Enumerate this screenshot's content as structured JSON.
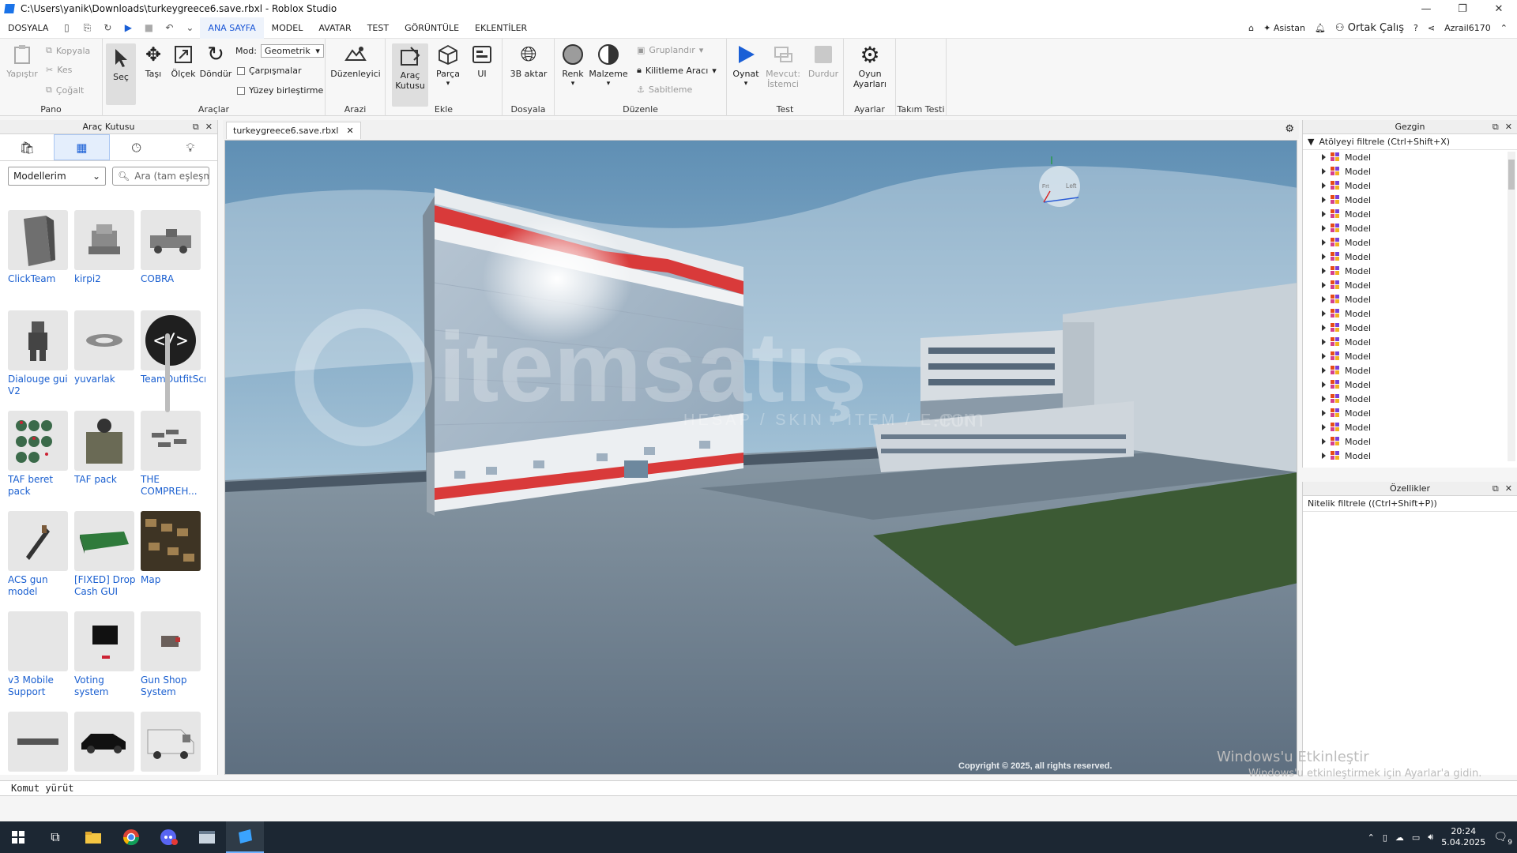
{
  "window": {
    "title": "C:\\Users\\yanik\\Downloads\\turkeygreece6.save.rbxl - Roblox Studio",
    "minimize": "—",
    "restore": "❐",
    "close": "✕"
  },
  "menu": {
    "tabs": [
      "DOSYALA",
      "ANA SAYFA",
      "MODEL",
      "AVATAR",
      "TEST",
      "GÖRÜNTÜLE",
      "EKLENTİLER"
    ],
    "active_tab": "ANA SAYFA",
    "right": {
      "assistant": "Asistan",
      "collab": "Ortak Çalış",
      "user": "Azrail6170"
    }
  },
  "ribbon": {
    "pano": {
      "label": "Pano",
      "paste": "Yapıştır",
      "copy": "Kopyala",
      "cut": "Kes",
      "duplicate": "Çoğalt"
    },
    "tools": {
      "label": "Araçlar",
      "select": "Seç",
      "move": "Taşı",
      "scale": "Ölçek",
      "rotate": "Döndür",
      "mode_label": "Mod:",
      "mode_value": "Geometrik",
      "collisions": "Çarpışmalar",
      "surface_join": "Yüzey birleştirme"
    },
    "terrain": {
      "label": "Arazi",
      "editor": "Düzenleyici"
    },
    "insert": {
      "label": "Ekle",
      "toolbox": "Araç Kutusu",
      "part": "Parça",
      "ui": "UI"
    },
    "file": {
      "label": "Dosyala",
      "import3d": "3B aktar"
    },
    "edit": {
      "label": "Düzenle",
      "color": "Renk",
      "material": "Malzeme",
      "group": "Gruplandır",
      "lock": "Kilitleme Aracı",
      "anchor": "Sabitleme"
    },
    "test": {
      "label": "Test",
      "play": "Oynat",
      "client": "Mevcut: İstemci",
      "stop": "Durdur"
    },
    "settings": {
      "label": "Ayarlar",
      "game_settings": "Oyun Ayarları"
    },
    "team": {
      "label": "Takım Testi"
    }
  },
  "toolbox": {
    "title": "Araç Kutusu",
    "category": "Modellerim",
    "search_placeholder": "Ara (tam eşleşme)",
    "items": [
      {
        "name": "ClickTeam"
      },
      {
        "name": "kirpi2"
      },
      {
        "name": "COBRA"
      },
      {
        "name": "Dialouge gui V2"
      },
      {
        "name": "yuvarlak"
      },
      {
        "name": "TeamOutfitScript"
      },
      {
        "name": "TAF beret pack"
      },
      {
        "name": "TAF pack"
      },
      {
        "name": "THE COMPREH..."
      },
      {
        "name": "ACS gun model"
      },
      {
        "name": "[FIXED] Drop Cash GUI"
      },
      {
        "name": "Map"
      },
      {
        "name": "v3 Mobile Support"
      },
      {
        "name": "Voting system"
      },
      {
        "name": "Gun Shop System"
      },
      {
        "name": ""
      },
      {
        "name": ""
      },
      {
        "name": ""
      }
    ]
  },
  "document": {
    "tab": "turkeygreece6.save.rbxl"
  },
  "viewport": {
    "watermark_brand": "itemsatış",
    "watermark_sub": "HESAP / SKIN / ITEM / E-PIN",
    "watermark_dom": ".com",
    "copyright": "Copyright © 2025, all rights reserved.",
    "cube_left": "Left",
    "cube_front": "Frt"
  },
  "explorer": {
    "title": "Gezgin",
    "filter": "Atölyeyi filtrele (Ctrl+Shift+X)",
    "rows": [
      "Model",
      "Model",
      "Model",
      "Model",
      "Model",
      "Model",
      "Model",
      "Model",
      "Model",
      "Model",
      "Model",
      "Model",
      "Model",
      "Model",
      "Model",
      "Model",
      "Model",
      "Model",
      "Model",
      "Model",
      "Model",
      "Model"
    ]
  },
  "properties": {
    "title": "Özellikler",
    "filter": "Nitelik filtrele ((Ctrl+Shift+P))"
  },
  "command": {
    "placeholder": "Komut yürüt"
  },
  "activation": {
    "title": "Windows'u Etkinleştir",
    "text": "Windows'u etkinleştirmek için Ayarlar'a gidin."
  },
  "taskbar": {
    "time": "20:24",
    "date": "5.04.2025",
    "notifications": "9"
  },
  "colors": {
    "accent": "#1a56d6",
    "play": "#1a5fd6",
    "taskbar": "#1c2733"
  }
}
